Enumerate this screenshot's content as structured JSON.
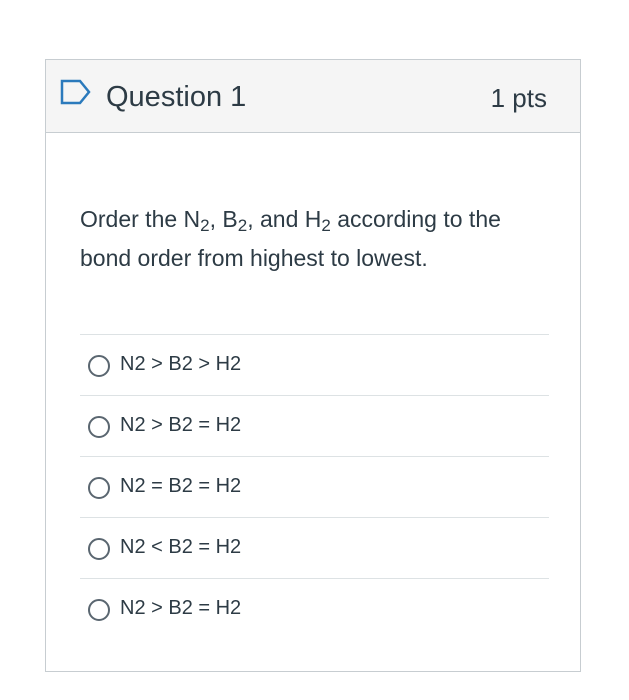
{
  "question": {
    "title": "Question 1",
    "points": "1 pts",
    "text_parts": {
      "t1": "Order the N",
      "s1": "2",
      "t2": ", B",
      "s2": "2",
      "t3": ", and H",
      "s3": "2",
      "t4": " according to the bond order from highest to lowest."
    }
  },
  "answers": [
    {
      "label": "N2 > B2 > H2"
    },
    {
      "label": "N2 > B2 = H2"
    },
    {
      "label": "N2 = B2 = H2"
    },
    {
      "label": "N2 < B2 = H2"
    },
    {
      "label": "N2 > B2 = H2"
    }
  ],
  "colors": {
    "header_bg": "#f5f5f5",
    "border": "#c7cdd1",
    "text": "#2d3b45",
    "flag_blue": "#2b7abc"
  },
  "icons": {
    "flag": "flag-outline-icon",
    "radio": "radio-unchecked-icon"
  }
}
